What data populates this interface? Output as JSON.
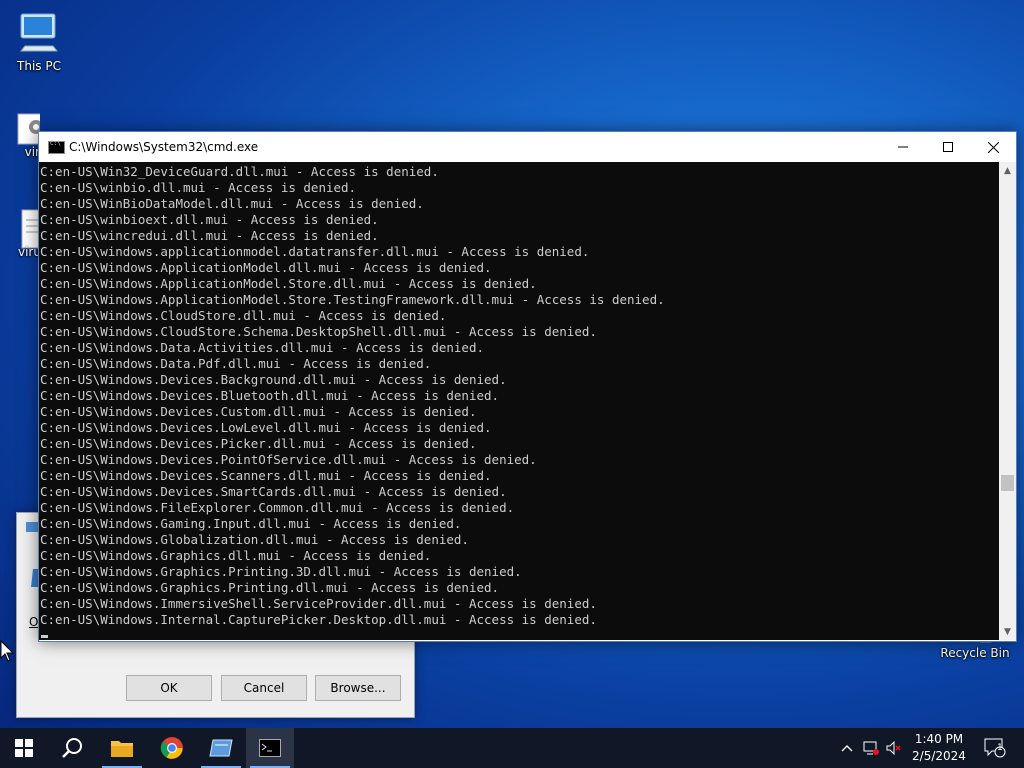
{
  "desktop": {
    "icons": [
      {
        "label": "This PC"
      },
      {
        "label": "vir"
      },
      {
        "label": "viru"
      },
      {
        "label": "Recycle Bin"
      }
    ]
  },
  "run_dialog": {
    "ok_label": "OK",
    "cancel_label": "Cancel",
    "browse_label": "Browse...",
    "partial_label": "O"
  },
  "cmd_window": {
    "title": "C:\\Windows\\System32\\cmd.exe",
    "lines": [
      "C:en-US\\Win32_DeviceGuard.dll.mui - Access is denied.",
      "C:en-US\\winbio.dll.mui - Access is denied.",
      "C:en-US\\WinBioDataModel.dll.mui - Access is denied.",
      "C:en-US\\winbioext.dll.mui - Access is denied.",
      "C:en-US\\wincredui.dll.mui - Access is denied.",
      "C:en-US\\windows.applicationmodel.datatransfer.dll.mui - Access is denied.",
      "C:en-US\\Windows.ApplicationModel.dll.mui - Access is denied.",
      "C:en-US\\Windows.ApplicationModel.Store.dll.mui - Access is denied.",
      "C:en-US\\Windows.ApplicationModel.Store.TestingFramework.dll.mui - Access is denied.",
      "C:en-US\\Windows.CloudStore.dll.mui - Access is denied.",
      "C:en-US\\Windows.CloudStore.Schema.DesktopShell.dll.mui - Access is denied.",
      "C:en-US\\Windows.Data.Activities.dll.mui - Access is denied.",
      "C:en-US\\Windows.Data.Pdf.dll.mui - Access is denied.",
      "C:en-US\\Windows.Devices.Background.dll.mui - Access is denied.",
      "C:en-US\\Windows.Devices.Bluetooth.dll.mui - Access is denied.",
      "C:en-US\\Windows.Devices.Custom.dll.mui - Access is denied.",
      "C:en-US\\Windows.Devices.LowLevel.dll.mui - Access is denied.",
      "C:en-US\\Windows.Devices.Picker.dll.mui - Access is denied.",
      "C:en-US\\Windows.Devices.PointOfService.dll.mui - Access is denied.",
      "C:en-US\\Windows.Devices.Scanners.dll.mui - Access is denied.",
      "C:en-US\\Windows.Devices.SmartCards.dll.mui - Access is denied.",
      "C:en-US\\Windows.FileExplorer.Common.dll.mui - Access is denied.",
      "C:en-US\\Windows.Gaming.Input.dll.mui - Access is denied.",
      "C:en-US\\Windows.Globalization.dll.mui - Access is denied.",
      "C:en-US\\Windows.Graphics.dll.mui - Access is denied.",
      "C:en-US\\Windows.Graphics.Printing.3D.dll.mui - Access is denied.",
      "C:en-US\\Windows.Graphics.Printing.dll.mui - Access is denied.",
      "C:en-US\\Windows.ImmersiveShell.ServiceProvider.dll.mui - Access is denied.",
      "C:en-US\\Windows.Internal.CapturePicker.Desktop.dll.mui - Access is denied."
    ]
  },
  "taskbar": {
    "apps": [
      {
        "name": "start-button-icon"
      },
      {
        "name": "search-icon"
      },
      {
        "name": "file-explorer-icon"
      },
      {
        "name": "chrome-icon"
      },
      {
        "name": "run-dialog-icon"
      },
      {
        "name": "cmd-icon"
      }
    ],
    "clock": {
      "time": "1:40 PM",
      "date": "2/5/2024"
    },
    "notification_count": "1"
  },
  "colors": {
    "console_bg": "#0c0c0c",
    "console_text": "#cccccc",
    "taskbar_bg": "#101828"
  }
}
